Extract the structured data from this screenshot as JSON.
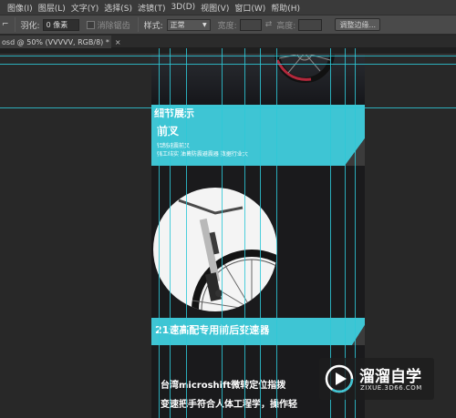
{
  "menubar": {
    "items": [
      "图像(I)",
      "图层(L)",
      "文字(Y)",
      "选择(S)",
      "滤镜(T)",
      "3D(D)",
      "视图(V)",
      "窗口(W)",
      "帮助(H)"
    ]
  },
  "options": {
    "feather_label": "羽化:",
    "feather_value": "0 像素",
    "antialias_label": "消除锯齿",
    "style_label": "样式:",
    "style_value": "正常",
    "width_label": "宽度:",
    "height_label": "高度:",
    "refine_edge_label": "调整边缘..."
  },
  "document_tab": {
    "title": "osd @ 50% (VVVVV, RGB/8) *",
    "close_glyph": "×"
  },
  "canvas": {
    "section_title": "细节展示",
    "feature_name": "前叉",
    "feature_line1": "铝制避震前叉",
    "feature_line2": "强工结实  油簧防震避震器   数据行业大",
    "banner2_text": "21速高配专用前后变速器",
    "desc_line1": "台湾microshift微转定位指拨",
    "desc_line2": "变速把手符合人体工程学，操作轻"
  },
  "watermark": {
    "brand": "溜溜自学",
    "url": "ZIXUE.3D66.COM"
  },
  "colors": {
    "accent": "#3ec5d4",
    "guide": "#2ec7d6",
    "canvas_bg": "#1a1a1c"
  }
}
